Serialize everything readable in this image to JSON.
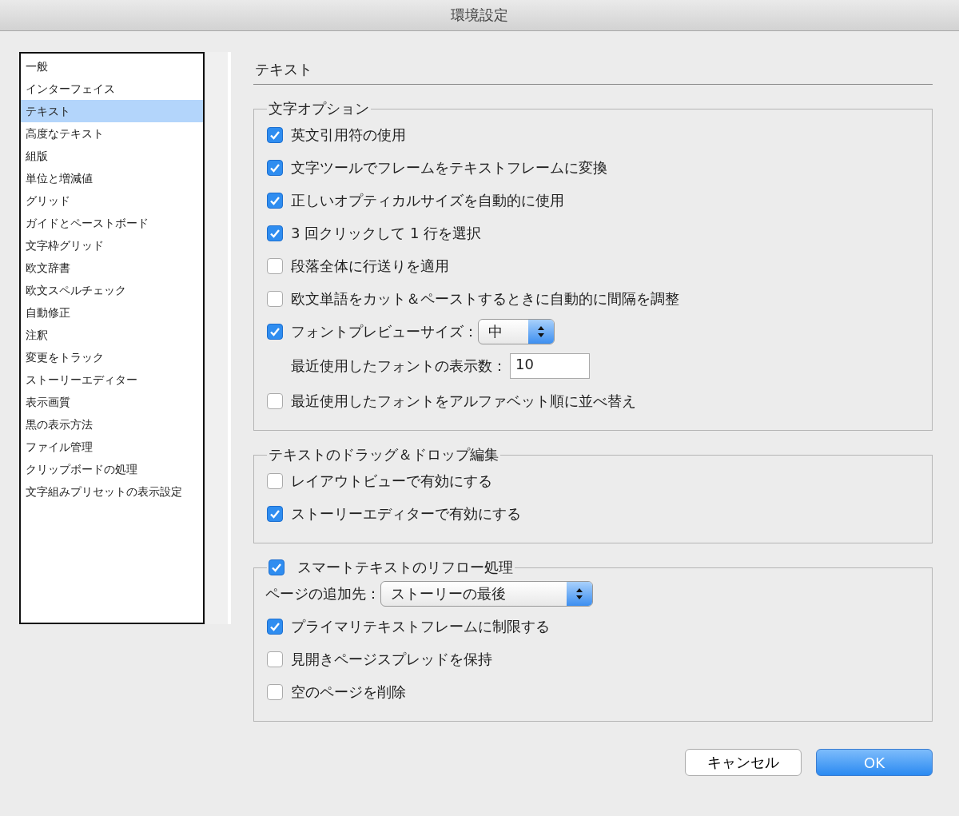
{
  "window": {
    "title": "環境設定"
  },
  "sidebar": {
    "items": [
      {
        "label": "一般",
        "selected": false
      },
      {
        "label": "インターフェイス",
        "selected": false
      },
      {
        "label": "テキスト",
        "selected": true
      },
      {
        "label": "高度なテキスト",
        "selected": false
      },
      {
        "label": "組版",
        "selected": false
      },
      {
        "label": "単位と増減値",
        "selected": false
      },
      {
        "label": "グリッド",
        "selected": false
      },
      {
        "label": "ガイドとペーストボード",
        "selected": false
      },
      {
        "label": "文字枠グリッド",
        "selected": false
      },
      {
        "label": "欧文辞書",
        "selected": false
      },
      {
        "label": "欧文スペルチェック",
        "selected": false
      },
      {
        "label": "自動修正",
        "selected": false
      },
      {
        "label": "注釈",
        "selected": false
      },
      {
        "label": "変更をトラック",
        "selected": false
      },
      {
        "label": "ストーリーエディター",
        "selected": false
      },
      {
        "label": "表示画質",
        "selected": false
      },
      {
        "label": "黒の表示方法",
        "selected": false
      },
      {
        "label": "ファイル管理",
        "selected": false
      },
      {
        "label": "クリップボードの処理",
        "selected": false
      },
      {
        "label": "文字組みプリセットの表示設定",
        "selected": false
      }
    ]
  },
  "section_title": "テキスト",
  "groups": [
    {
      "kind": "plain",
      "title": "文字オプション",
      "rows": [
        {
          "kind": "checkbox",
          "label": "英文引用符の使用",
          "checked": true
        },
        {
          "kind": "checkbox",
          "label": "文字ツールでフレームをテキストフレームに変換",
          "checked": true
        },
        {
          "kind": "checkbox",
          "label": "正しいオプティカルサイズを自動的に使用",
          "checked": true
        },
        {
          "kind": "checkbox",
          "label": "3 回クリックして 1 行を選択",
          "checked": true
        },
        {
          "kind": "checkbox",
          "label": "段落全体に行送りを適用",
          "checked": false
        },
        {
          "kind": "checkbox",
          "label": "欧文単語をカット＆ペーストするときに自動的に間隔を調整",
          "checked": false
        },
        {
          "kind": "checkbox_select",
          "label": "フォントプレビューサイズ：",
          "checked": true,
          "value": "中"
        },
        {
          "kind": "number_field",
          "label": "最近使用したフォントの表示数：",
          "value": "10"
        },
        {
          "kind": "checkbox",
          "label": "最近使用したフォントをアルファベット順に並べ替え",
          "checked": false
        }
      ]
    },
    {
      "kind": "plain",
      "title": "テキストのドラッグ＆ドロップ編集",
      "rows": [
        {
          "kind": "checkbox",
          "label": "レイアウトビューで有効にする",
          "checked": false
        },
        {
          "kind": "checkbox",
          "label": "ストーリーエディターで有効にする",
          "checked": true
        }
      ]
    },
    {
      "kind": "checkbox",
      "title": "スマートテキストのリフロー処理",
      "checked": true,
      "rows": [
        {
          "kind": "select",
          "label": "ページの追加先：",
          "value": "ストーリーの最後"
        },
        {
          "kind": "checkbox",
          "label": "プライマリテキストフレームに制限する",
          "checked": true
        },
        {
          "kind": "checkbox",
          "label": "見開きページスプレッドを保持",
          "checked": false
        },
        {
          "kind": "checkbox",
          "label": "空のページを削除",
          "checked": false
        }
      ]
    }
  ],
  "buttons": [
    {
      "label": "キャンセル",
      "kind": "normal"
    },
    {
      "label": "OK",
      "kind": "default"
    }
  ]
}
